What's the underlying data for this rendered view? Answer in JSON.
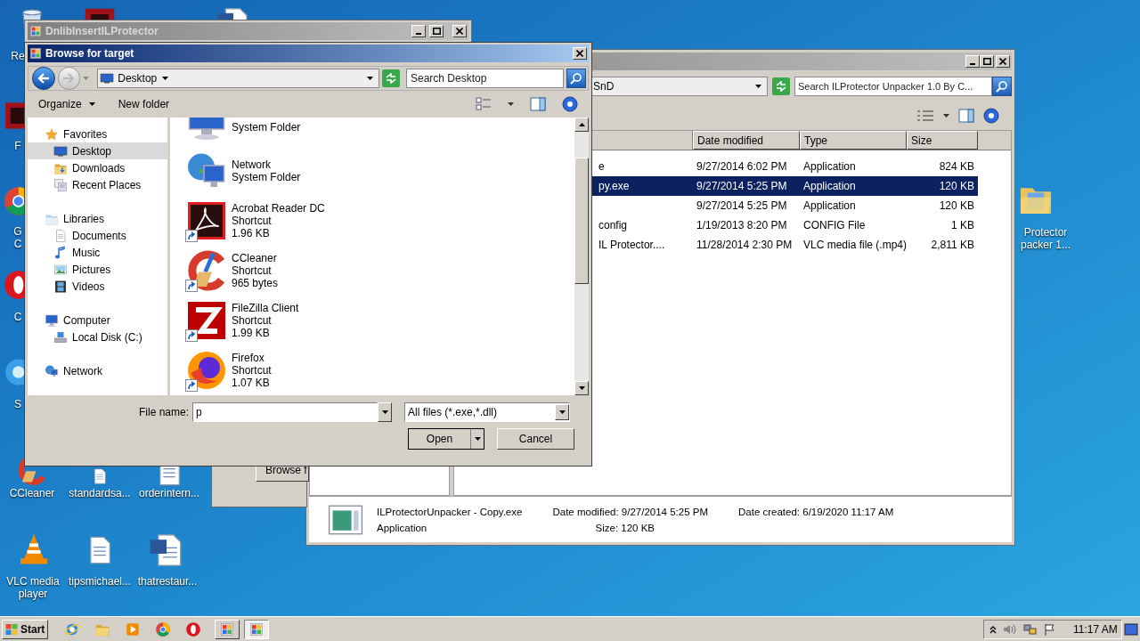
{
  "desktop_icons": [
    {
      "kind": "bin",
      "lines": [
        "Re"
      ]
    },
    {
      "kind": "redapp",
      "lines": [
        "F"
      ]
    },
    {
      "kind": "chrome",
      "lines": [
        "G",
        "C"
      ]
    },
    {
      "kind": "opera",
      "lines": [
        "C"
      ]
    },
    {
      "kind": "blueapp",
      "lines": [
        "S"
      ]
    },
    {
      "kind": "ccleaner",
      "lines": [
        "CCleaner"
      ]
    },
    {
      "kind": "doc",
      "lines": [
        "standardsa..."
      ]
    },
    {
      "kind": "doc",
      "lines": [
        "orderintern..."
      ]
    },
    {
      "kind": "vlc",
      "lines": [
        "VLC media",
        "player"
      ]
    },
    {
      "kind": "doc",
      "lines": [
        "tipsmichael..."
      ]
    },
    {
      "kind": "word",
      "lines": [
        "thatrestaur..."
      ]
    },
    {
      "kind": "folder",
      "lines": [
        "Protector",
        "packer 1..."
      ]
    },
    {
      "kind": "redapp"
    },
    {
      "kind": "word"
    }
  ],
  "explorer": {
    "address": "SnD",
    "search_placeholder": "Search ILProtector Unpacker 1.0 By C...",
    "columns": [
      "Date modified",
      "Type",
      "Size"
    ],
    "rows": [
      {
        "name": "e",
        "date": "9/27/2014 6:02 PM",
        "type": "Application",
        "size": "824 KB",
        "selected": false
      },
      {
        "name": "py.exe",
        "date": "9/27/2014 5:25 PM",
        "type": "Application",
        "size": "120 KB",
        "selected": true
      },
      {
        "date": "9/27/2014 5:25 PM",
        "type": "Application",
        "size": "120 KB",
        "selected": false
      },
      {
        "name": "config",
        "date": "1/19/2013 8:20 PM",
        "type": "CONFIG File",
        "size": "1 KB",
        "selected": false
      },
      {
        "name": "IL Protector....",
        "date": "11/28/2014 2:30 PM",
        "type": "VLC media file (.mp4)",
        "size": "2,811 KB",
        "selected": false
      }
    ],
    "details": {
      "name": "ILProtectorUnpacker - Copy.exe",
      "type": "Application",
      "modified": "Date modified: 9/27/2014 5:25 PM",
      "size": "Size: 120 KB",
      "created": "Date created: 6/19/2020 11:17 AM"
    }
  },
  "app_window": {
    "title": "DnlibInsertILProtector",
    "button": "Browse f"
  },
  "dialog": {
    "title": "Browse for target",
    "location": "Desktop",
    "search_placeholder": "Search Desktop",
    "toolbar": [
      {
        "label": "Organize",
        "menu": true
      },
      {
        "label": "New folder",
        "menu": false
      }
    ],
    "nav": [
      {
        "label": "Favorites",
        "kind": "star",
        "selected": false,
        "children": [
          {
            "label": "Desktop",
            "kind": "desktop",
            "selected": true
          },
          {
            "label": "Downloads",
            "kind": "downloads",
            "selected": false
          },
          {
            "label": "Recent Places",
            "kind": "recent",
            "selected": false
          }
        ]
      },
      {
        "label": "Libraries",
        "kind": "libraries",
        "selected": false,
        "children": [
          {
            "label": "Documents",
            "kind": "documents",
            "selected": false
          },
          {
            "label": "Music",
            "kind": "music",
            "selected": false
          },
          {
            "label": "Pictures",
            "kind": "pictures",
            "selected": false
          },
          {
            "label": "Videos",
            "kind": "videos",
            "selected": false
          }
        ]
      },
      {
        "label": "Computer",
        "kind": "computer",
        "selected": false,
        "children": [
          {
            "label": "Local Disk (C:)",
            "kind": "disk",
            "selected": false
          }
        ]
      },
      {
        "label": "Network",
        "kind": "network",
        "selected": false
      }
    ],
    "files": [
      {
        "kind": "computer",
        "shortcut": false,
        "lines": [
          "System Folder"
        ]
      },
      {
        "kind": "network",
        "shortcut": false,
        "lines": [
          "Network",
          "System Folder"
        ]
      },
      {
        "kind": "acrobat",
        "shortcut": true,
        "lines": [
          "Acrobat Reader DC",
          "Shortcut",
          "1.96 KB"
        ]
      },
      {
        "kind": "ccleaner",
        "shortcut": true,
        "lines": [
          "CCleaner",
          "Shortcut",
          "965 bytes"
        ]
      },
      {
        "kind": "filezilla",
        "shortcut": true,
        "lines": [
          "FileZilla Client",
          "Shortcut",
          "1.99 KB"
        ]
      },
      {
        "kind": "firefox",
        "shortcut": true,
        "lines": [
          "Firefox",
          "Shortcut",
          "1.07 KB"
        ]
      }
    ],
    "file_name_label": "File name:",
    "file_name": "p",
    "filter": "All files (*.exe,*.dll)",
    "open": "Open",
    "cancel": "Cancel"
  },
  "taskbar": {
    "start": "Start",
    "apps": [
      {
        "kind": "ie",
        "active": false
      },
      {
        "kind": "explorer",
        "active": false
      },
      {
        "kind": "media",
        "active": false
      },
      {
        "kind": "chrome",
        "active": false
      },
      {
        "kind": "opera",
        "active": false
      },
      {
        "kind": "task",
        "active": false
      },
      {
        "kind": "task",
        "active": true
      }
    ],
    "clock": "11:17 AM"
  }
}
